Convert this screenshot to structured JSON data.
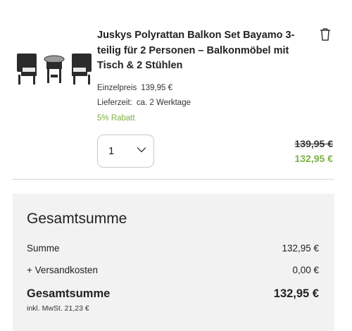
{
  "item": {
    "title": "Juskys Polyrattan Balkon Set Bayamo 3-teilig für 2 Personen – Balkonmöbel mit Tisch & 2 Stühlen",
    "image_icon": "balcony-furniture-set-image",
    "unit_price_label": "Einzelpreis",
    "unit_price_value": "139,95 €",
    "delivery_label": "Lieferzeit:",
    "delivery_value": "ca. 2 Werktage",
    "discount": "5% Rabatt",
    "quantity": "1",
    "price_old": "139,95 €",
    "price_new": "132,95 €",
    "delete_icon": "trash-icon"
  },
  "summary": {
    "title": "Gesamtsumme",
    "subtotal_label": "Summe",
    "subtotal_value": "132,95 €",
    "shipping_label": "+ Versandkosten",
    "shipping_value": "0,00 €",
    "total_label": "Gesamtsumme",
    "total_value": "132,95 €",
    "tax_note": "inkl. MwSt. 21,23 €"
  },
  "colors": {
    "accent_green": "#7cb342",
    "summary_bg": "#f2f2f2",
    "text": "#1f1f1f"
  }
}
